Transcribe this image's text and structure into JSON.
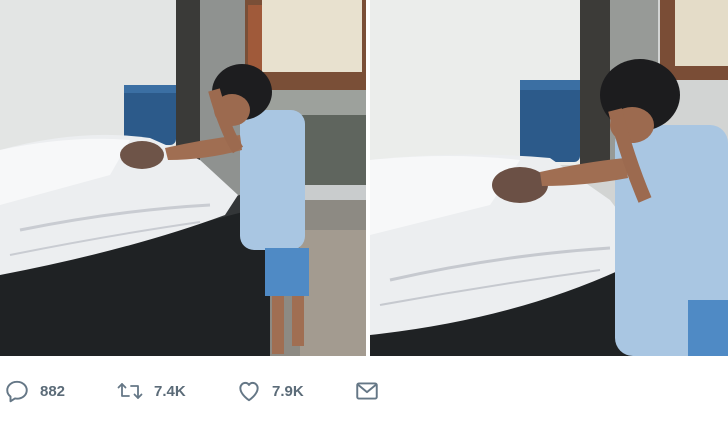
{
  "tweet": {
    "media": [
      {
        "icon": "photo-left"
      },
      {
        "icon": "photo-right"
      }
    ],
    "actions": {
      "reply": {
        "icon": "reply-icon",
        "count": "882"
      },
      "retweet": {
        "icon": "retweet-icon",
        "count": "7.4K"
      },
      "like": {
        "icon": "heart-icon",
        "count": "7.9K"
      },
      "message": {
        "icon": "envelope-icon"
      }
    }
  },
  "colors": {
    "action_gray": "#657786",
    "count_gray": "#5b6b78",
    "background": "#ffffff"
  }
}
